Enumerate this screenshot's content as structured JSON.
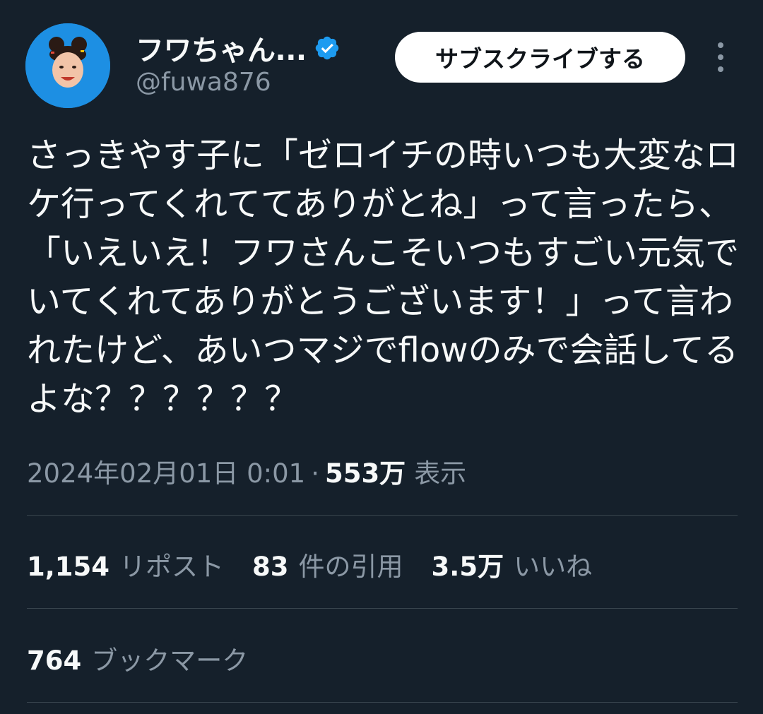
{
  "author": {
    "display_name": "フワちゃん...",
    "handle": "@fuwa876",
    "verified": true,
    "avatar_icon": "profile-photo",
    "accent": "#1d9bf0"
  },
  "header": {
    "subscribe_label": "サブスクライブする",
    "more_icon": "vertical-ellipsis-icon"
  },
  "tweet": {
    "text": "さっきやす子に「ゼロイチの時いつも大変なロケ行ってくれててありがとね」って言ったら、「いえいえ！フワさんこそいつもすごい元気でいてくれてありがとうございます！」って言われたけど、あいつマジでflowのみで会話してるよな？？？？？？",
    "timestamp": "2024年02月01日 0:01",
    "separator": "·",
    "views_count": "553万",
    "views_label": "表示"
  },
  "stats": [
    {
      "num": "1,154",
      "label": "リポスト"
    },
    {
      "num": "83",
      "label": "件の引用"
    },
    {
      "num": "3.5万",
      "label": "いいね"
    }
  ],
  "bookmarks": {
    "num": "764",
    "label": "ブックマーク"
  },
  "colors": {
    "background": "#15202b",
    "text": "#f7f9f9",
    "secondary": "#8b98a5",
    "divider": "#38444d"
  }
}
